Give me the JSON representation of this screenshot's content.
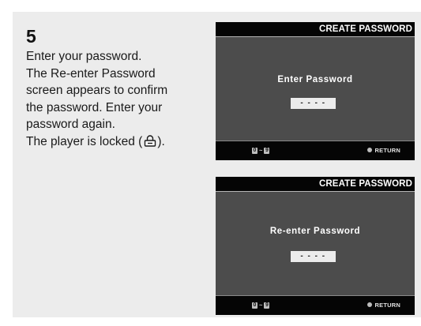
{
  "step": {
    "number": "5",
    "lines": [
      "Enter your password.",
      "The Re-enter Password",
      "screen appears to confirm",
      "the password. Enter your",
      "password again.",
      "The player is locked ("
    ],
    "last_line_suffix": ").",
    "lock_icon": "lock-icon"
  },
  "screens": [
    {
      "title": "CREATE PASSWORD",
      "prompt": "Enter Password",
      "password_mask": "- - - -",
      "digit_from": "0",
      "digit_sep": "~",
      "digit_to": "9",
      "return_label": "RETURN"
    },
    {
      "title": "CREATE PASSWORD",
      "prompt": "Re-enter Password",
      "password_mask": "- - - -",
      "digit_from": "0",
      "digit_sep": "~",
      "digit_to": "9",
      "return_label": "RETURN"
    }
  ]
}
